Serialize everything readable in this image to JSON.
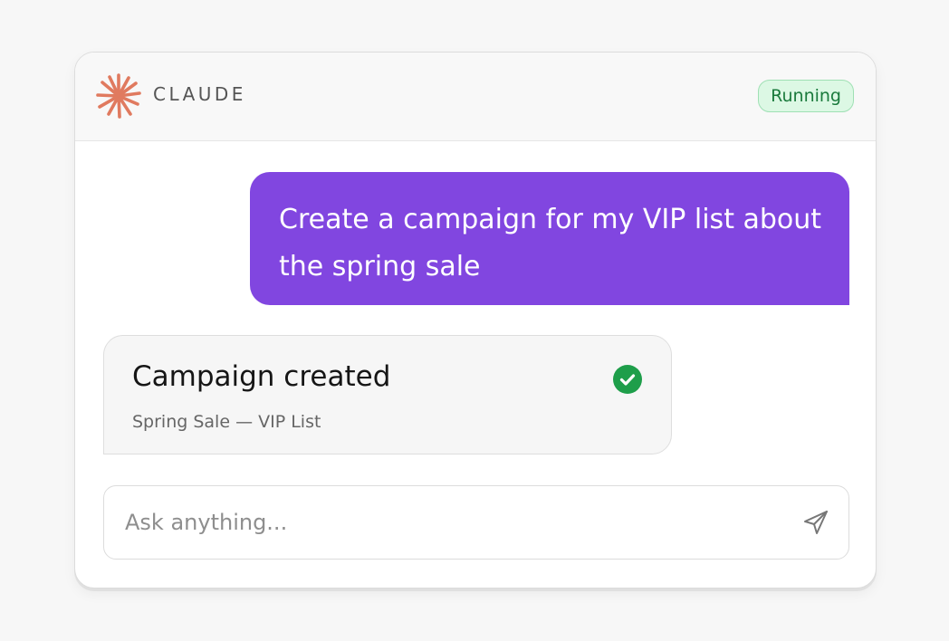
{
  "app": {
    "brand": "CLAUDE",
    "status": "Running"
  },
  "colors": {
    "accent": "#8146e0",
    "logo": "#e07a5f",
    "status_bg": "#dcf8e4",
    "status_text": "#1a7a3c",
    "success": "#1e9e4a"
  },
  "conversation": {
    "user_message": "Create a campaign for my VIP list about the spring sale",
    "result": {
      "title": "Campaign created",
      "subtitle": "Spring Sale — VIP List",
      "icon": "check-circle-icon"
    }
  },
  "input": {
    "placeholder": "Ask anything...",
    "value": "",
    "send_icon": "send-icon"
  }
}
